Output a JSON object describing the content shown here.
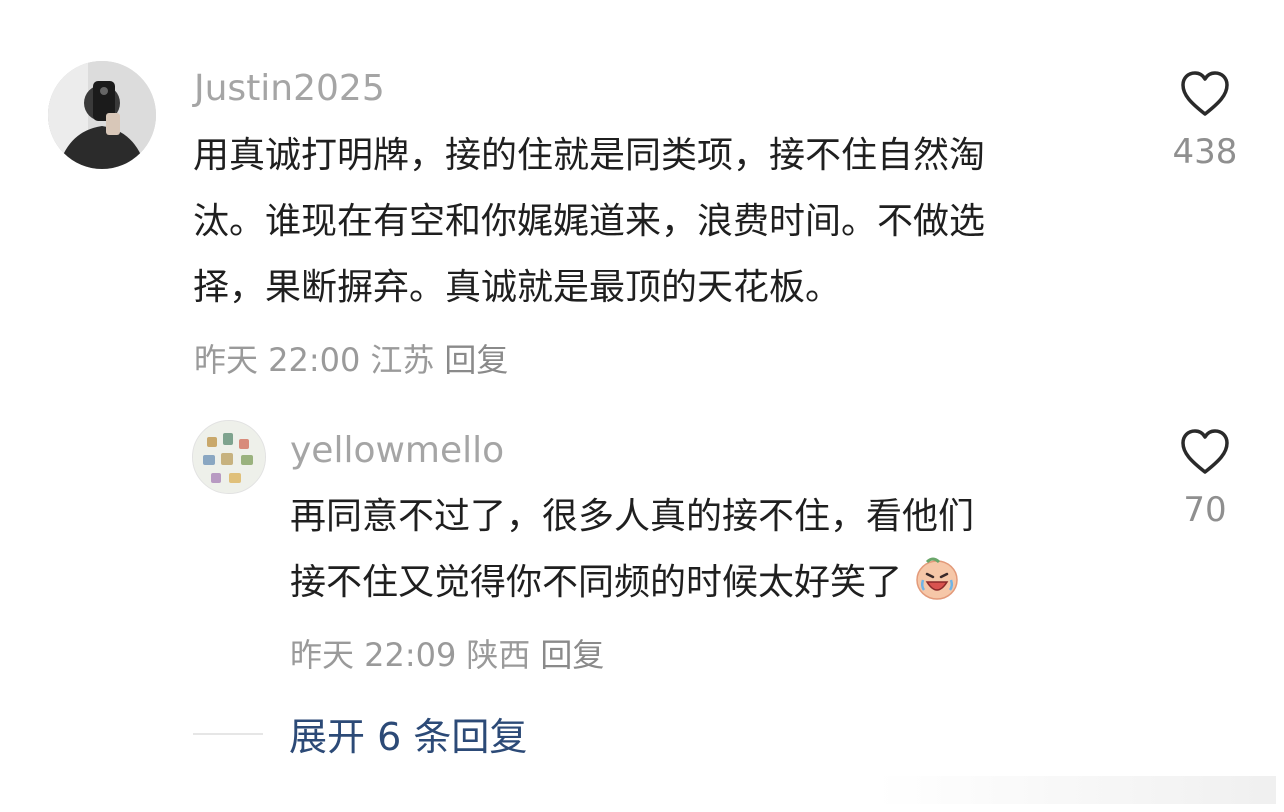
{
  "comments": [
    {
      "username": "Justin2025",
      "text_lines": [
        "用真诚打明牌，接的住就是同类项，接不住自然淘",
        "汰。谁现在有空和你娓娓道来，浪费时间。不做选",
        "择，果断摒弃。真诚就是最顶的天花板。"
      ],
      "time": "昨天 22:00",
      "location": "江苏",
      "reply_label": "回复",
      "likes": "438",
      "reply": {
        "username": "yellowmello",
        "text_lines": [
          "再同意不过了，很多人真的接不住，看他们",
          "接不住又觉得你不同频的时候太好笑了"
        ],
        "time": "昨天 22:09",
        "location": "陕西",
        "reply_label": "回复",
        "likes": "70"
      }
    }
  ],
  "expand": {
    "label": "展开 6 条回复"
  },
  "icons": {
    "like": "heart-outline-icon",
    "emoji": "laughing-cry-emoji-icon"
  },
  "colors": {
    "username": "#a5a5a5",
    "text": "#1f1f1f",
    "meta": "#9a9a9a",
    "expand_link": "#2c4a77"
  }
}
